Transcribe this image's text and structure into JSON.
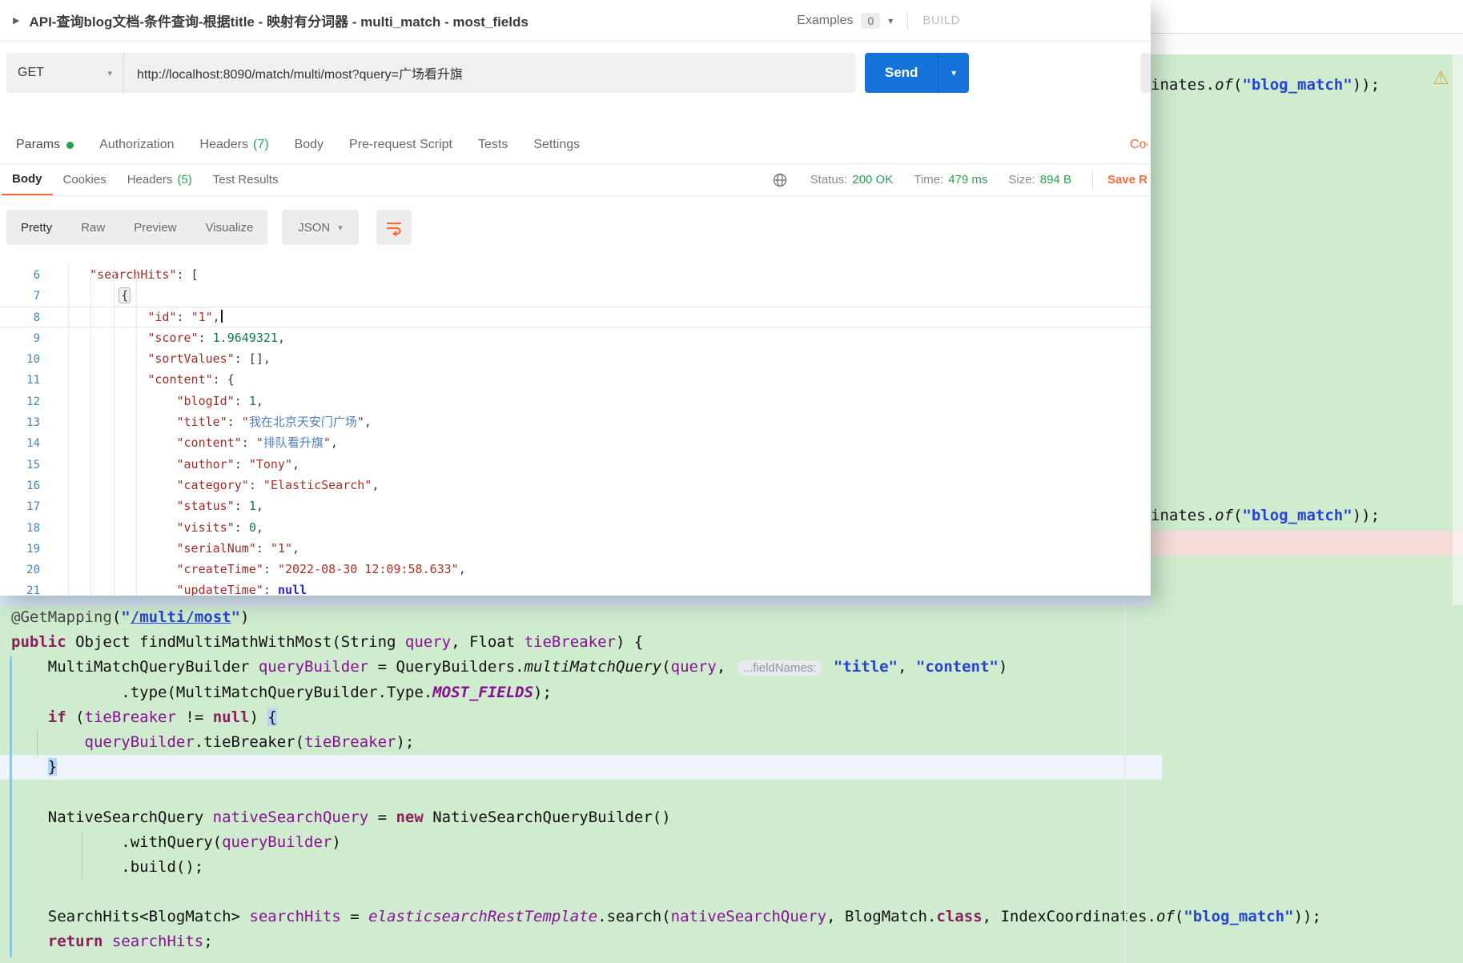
{
  "postman": {
    "collapse_glyph": "▶",
    "caret_glyph": "▾",
    "title": "API-查询blog文档-条件查询-根据title - 映射有分词器 - multi_match - most_fields",
    "examples_label": "Examples",
    "examples_count": "0",
    "build_label": "BUILD",
    "request": {
      "method": "GET",
      "url": "http://localhost:8090/match/multi/most?query=广场看升旗",
      "send_label": "Send"
    },
    "request_tabs": {
      "params": "Params",
      "authorization": "Authorization",
      "headers": "Headers",
      "headers_count": "(7)",
      "body": "Body",
      "prerequest": "Pre-request Script",
      "tests": "Tests",
      "settings": "Settings",
      "cookies_clipped": "Cookies"
    },
    "response_tabs": {
      "body": "Body",
      "cookies": "Cookies",
      "headers": "Headers",
      "headers_count": "(5)",
      "test_results": "Test Results"
    },
    "response_meta": {
      "status_label": "Status:",
      "status_value": "200 OK",
      "time_label": "Time:",
      "time_value": "479 ms",
      "size_label": "Size:",
      "size_value": "894 B",
      "save_label": "Save R"
    },
    "view_tabs": {
      "pretty": "Pretty",
      "raw": "Raw",
      "preview": "Preview",
      "visualize": "Visualize",
      "format": "JSON"
    },
    "json_lines": [
      {
        "n": "6",
        "seg": [
          [
            "    ",
            "pun"
          ],
          [
            "\"searchHits\"",
            "key"
          ],
          [
            ": [",
            "pun"
          ]
        ]
      },
      {
        "n": "7",
        "seg": [
          [
            "        ",
            "pun"
          ],
          [
            "{",
            "fold"
          ]
        ]
      },
      {
        "n": "8",
        "cur": true,
        "seg": [
          [
            "            ",
            "pun"
          ],
          [
            "\"id\"",
            "key"
          ],
          [
            ": ",
            "pun"
          ],
          [
            "\"1\"",
            "str"
          ],
          [
            ",",
            "pun"
          ],
          [
            "",
            "caret"
          ]
        ]
      },
      {
        "n": "9",
        "seg": [
          [
            "            ",
            "pun"
          ],
          [
            "\"score\"",
            "key"
          ],
          [
            ": ",
            "pun"
          ],
          [
            "1.9649321",
            "num"
          ],
          [
            ",",
            "pun"
          ]
        ]
      },
      {
        "n": "10",
        "seg": [
          [
            "            ",
            "pun"
          ],
          [
            "\"sortValues\"",
            "key"
          ],
          [
            ": [],",
            "pun"
          ]
        ]
      },
      {
        "n": "11",
        "seg": [
          [
            "            ",
            "pun"
          ],
          [
            "\"content\"",
            "key"
          ],
          [
            ": {",
            "pun"
          ]
        ]
      },
      {
        "n": "12",
        "seg": [
          [
            "                ",
            "pun"
          ],
          [
            "\"blogId\"",
            "key"
          ],
          [
            ": ",
            "pun"
          ],
          [
            "1",
            "num"
          ],
          [
            ",",
            "pun"
          ]
        ]
      },
      {
        "n": "13",
        "seg": [
          [
            "                ",
            "pun"
          ],
          [
            "\"title\"",
            "key"
          ],
          [
            ": ",
            "pun"
          ],
          [
            "\"",
            "str"
          ],
          [
            "我在北京天安门广场",
            "cjk"
          ],
          [
            "\"",
            "str"
          ],
          [
            ",",
            "pun"
          ]
        ]
      },
      {
        "n": "14",
        "seg": [
          [
            "                ",
            "pun"
          ],
          [
            "\"content\"",
            "key"
          ],
          [
            ": ",
            "pun"
          ],
          [
            "\"",
            "str"
          ],
          [
            "排队看升旗",
            "cjk"
          ],
          [
            "\"",
            "str"
          ],
          [
            ",",
            "pun"
          ]
        ]
      },
      {
        "n": "15",
        "seg": [
          [
            "                ",
            "pun"
          ],
          [
            "\"author\"",
            "key"
          ],
          [
            ": ",
            "pun"
          ],
          [
            "\"Tony\"",
            "str"
          ],
          [
            ",",
            "pun"
          ]
        ]
      },
      {
        "n": "16",
        "seg": [
          [
            "                ",
            "pun"
          ],
          [
            "\"category\"",
            "key"
          ],
          [
            ": ",
            "pun"
          ],
          [
            "\"ElasticSearch\"",
            "str"
          ],
          [
            ",",
            "pun"
          ]
        ]
      },
      {
        "n": "17",
        "seg": [
          [
            "                ",
            "pun"
          ],
          [
            "\"status\"",
            "key"
          ],
          [
            ": ",
            "pun"
          ],
          [
            "1",
            "num"
          ],
          [
            ",",
            "pun"
          ]
        ]
      },
      {
        "n": "18",
        "seg": [
          [
            "                ",
            "pun"
          ],
          [
            "\"visits\"",
            "key"
          ],
          [
            ": ",
            "pun"
          ],
          [
            "0",
            "num"
          ],
          [
            ",",
            "pun"
          ]
        ]
      },
      {
        "n": "19",
        "seg": [
          [
            "                ",
            "pun"
          ],
          [
            "\"serialNum\"",
            "key"
          ],
          [
            ": ",
            "pun"
          ],
          [
            "\"1\"",
            "str"
          ],
          [
            ",",
            "pun"
          ]
        ]
      },
      {
        "n": "20",
        "seg": [
          [
            "                ",
            "pun"
          ],
          [
            "\"createTime\"",
            "key"
          ],
          [
            ": ",
            "pun"
          ],
          [
            "\"2022-08-30 12:09:58.633\"",
            "str"
          ],
          [
            ",",
            "pun"
          ]
        ]
      },
      {
        "n": "21",
        "seg": [
          [
            "                ",
            "pun"
          ],
          [
            "\"updateTime\"",
            "key"
          ],
          [
            ": ",
            "pun"
          ],
          [
            "null",
            "nul"
          ]
        ]
      }
    ]
  },
  "ide": {
    "warning_glyph": "⚠",
    "tail_segments": [
      [
        "inates.",
        "pln"
      ],
      [
        "of",
        "jm"
      ],
      [
        "(",
        "pln"
      ],
      [
        "\"blog_match\"",
        "js"
      ],
      [
        "));",
        "pln"
      ]
    ],
    "code_lines": [
      {
        "seg": [
          [
            "@GetMapping",
            "ann"
          ],
          [
            "(",
            "pln"
          ],
          [
            "\"",
            "js"
          ],
          [
            "/multi/most",
            "jsl"
          ],
          [
            "\"",
            "js"
          ],
          [
            ")",
            "pln"
          ]
        ]
      },
      {
        "seg": [
          [
            "public",
            "jk"
          ],
          [
            " Object findMultiMathWithMost(String ",
            "pln"
          ],
          [
            "query",
            "jv"
          ],
          [
            ", Float ",
            "pln"
          ],
          [
            "tieBreaker",
            "jv"
          ],
          [
            ") {",
            "pln"
          ]
        ]
      },
      {
        "seg": [
          [
            "    MultiMatchQueryBuilder ",
            "pln"
          ],
          [
            "queryBuilder",
            "jv"
          ],
          [
            " = QueryBuilders.",
            "pln"
          ],
          [
            "multiMatchQuery",
            "jm"
          ],
          [
            "(",
            "pln"
          ],
          [
            "query",
            "jv"
          ],
          [
            ", ",
            "pln"
          ],
          [
            "...fieldNames:",
            "hint"
          ],
          [
            " ",
            "pln"
          ],
          [
            "\"title\"",
            "js"
          ],
          [
            ", ",
            "pln"
          ],
          [
            "\"content\"",
            "js"
          ],
          [
            ")",
            "pln"
          ]
        ]
      },
      {
        "seg": [
          [
            "            .type(MultiMatchQueryBuilder.Type.",
            "pln"
          ],
          [
            "MOST_FIELDS",
            "jc"
          ],
          [
            ");",
            "pln"
          ]
        ]
      },
      {
        "seg": [
          [
            "    ",
            "pln"
          ],
          [
            "if",
            "jk"
          ],
          [
            " (",
            "pln"
          ],
          [
            "tieBreaker",
            "jv"
          ],
          [
            " != ",
            "pln"
          ],
          [
            "null",
            "jk"
          ],
          [
            ") ",
            "pln"
          ],
          [
            "{",
            "bm"
          ]
        ]
      },
      {
        "seg": [
          [
            "        ",
            "pln"
          ],
          [
            "queryBuilder",
            "jv"
          ],
          [
            ".tieBreaker(",
            "pln"
          ],
          [
            "tieBreaker",
            "jv"
          ],
          [
            ");",
            "pln"
          ]
        ]
      },
      {
        "cls": "caret-row",
        "seg": [
          [
            "    ",
            "pln"
          ],
          [
            "}",
            "bm"
          ]
        ]
      },
      {
        "seg": []
      },
      {
        "seg": [
          [
            "    NativeSearchQuery ",
            "pln"
          ],
          [
            "nativeSearchQuery",
            "jv"
          ],
          [
            " = ",
            "pln"
          ],
          [
            "new",
            "jk"
          ],
          [
            " NativeSearchQueryBuilder()",
            "pln"
          ]
        ]
      },
      {
        "seg": [
          [
            "            .withQuery(",
            "pln"
          ],
          [
            "queryBuilder",
            "jv"
          ],
          [
            ")",
            "pln"
          ]
        ]
      },
      {
        "seg": [
          [
            "            .build();",
            "pln"
          ]
        ]
      },
      {
        "seg": []
      },
      {
        "seg": [
          [
            "    SearchHits<BlogMatch> ",
            "pln"
          ],
          [
            "searchHits",
            "jv"
          ],
          [
            " = ",
            "pln"
          ],
          [
            "elasticsearchRestTemplate",
            "jvi"
          ],
          [
            ".search(",
            "pln"
          ],
          [
            "nativeSearchQuery",
            "jv"
          ],
          [
            ", BlogMatch.",
            "pln"
          ],
          [
            "class",
            "jk"
          ],
          [
            ", IndexCoordinates.",
            "pln"
          ],
          [
            "of",
            "jm"
          ],
          [
            "(",
            "pln"
          ],
          [
            "\"blog_match\"",
            "js"
          ],
          [
            "));",
            "pln"
          ]
        ]
      },
      {
        "seg": [
          [
            "    ",
            "pln"
          ],
          [
            "return",
            "jk"
          ],
          [
            " ",
            "pln"
          ],
          [
            "searchHits",
            "jv"
          ],
          [
            ";",
            "pln"
          ]
        ]
      }
    ]
  }
}
